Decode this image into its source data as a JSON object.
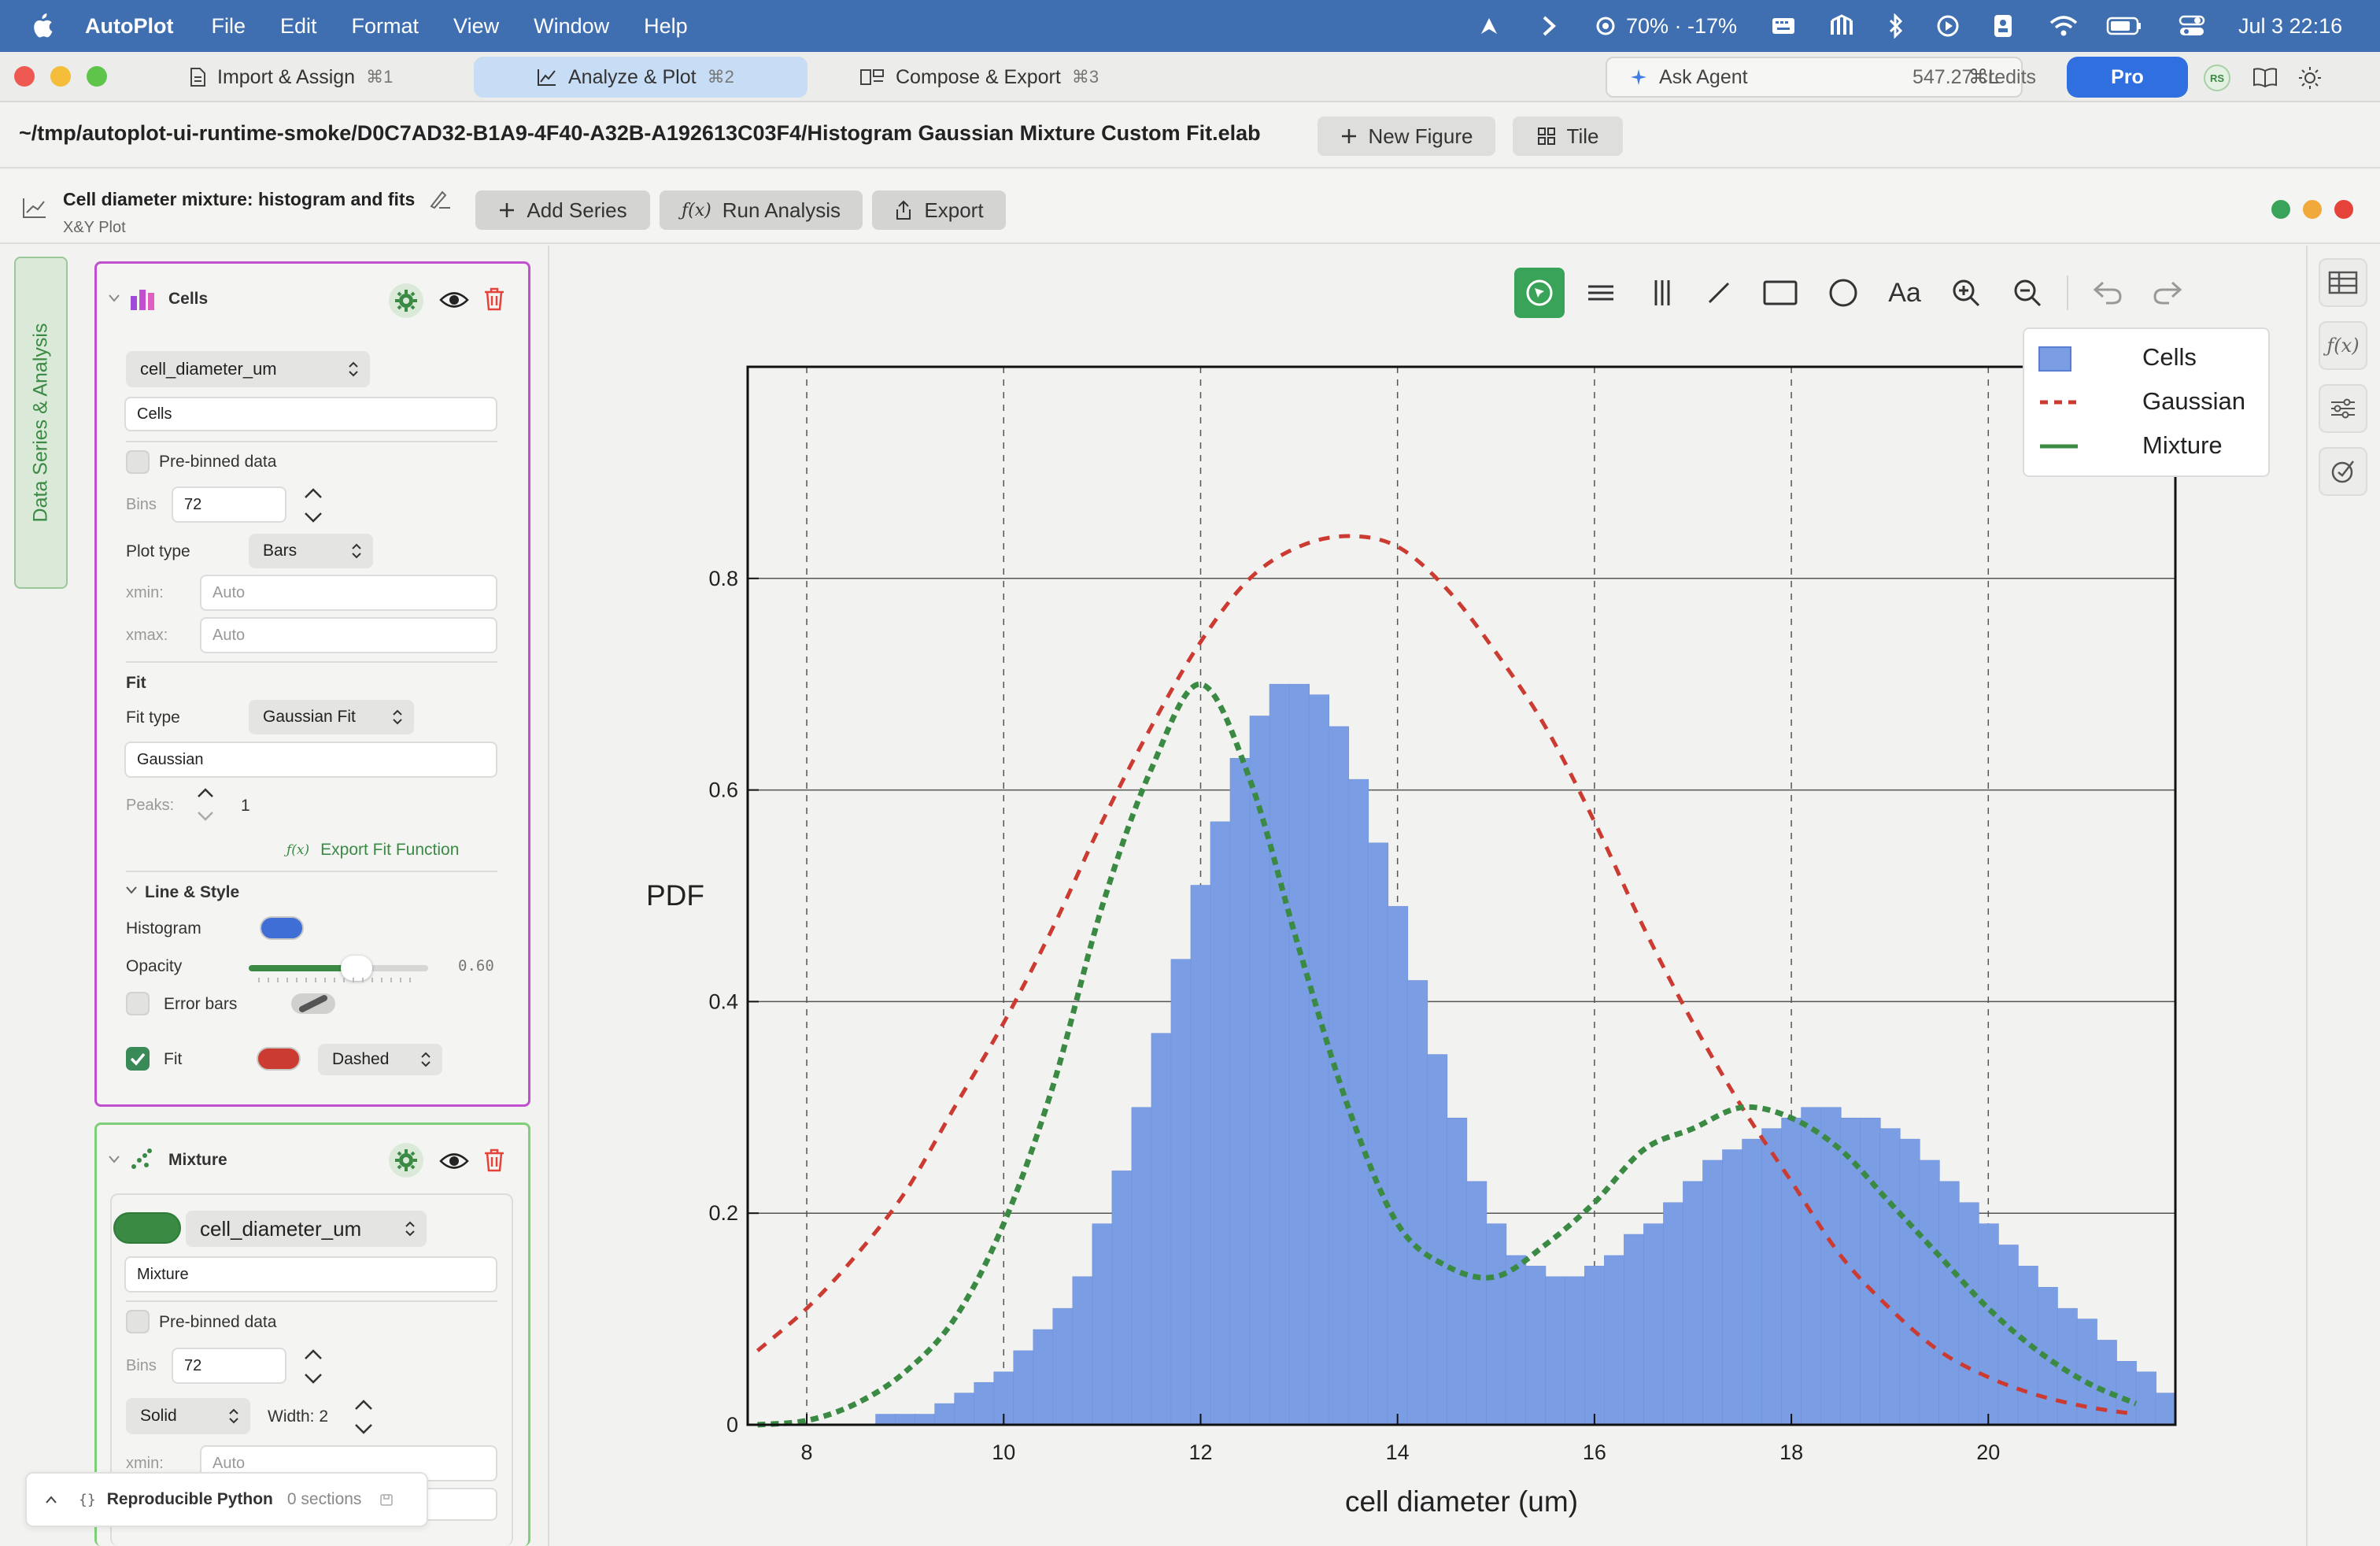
{
  "menubar": {
    "app_name": "AutoPlot",
    "menus": [
      "File",
      "Edit",
      "Format",
      "View",
      "Window",
      "Help"
    ],
    "battery_text": "70% · -17%",
    "clock": "Jul 3  22:16"
  },
  "tabs": [
    {
      "label": "Import & Assign",
      "shortcut": "⌘1",
      "active": false
    },
    {
      "label": "Analyze & Plot",
      "shortcut": "⌘2",
      "active": true
    },
    {
      "label": "Compose & Export",
      "shortcut": "⌘3",
      "active": false
    }
  ],
  "header_right": {
    "ask_agent": "Ask Agent",
    "ask_shortcut": "⌘L",
    "credits": "547.27 credits",
    "pro": "Pro",
    "avatar": "RS"
  },
  "pathbar": {
    "path": "~/tmp/autoplot-ui-runtime-smoke/D0C7AD32-B1A9-4F40-A32B-A192613C03F4/Histogram Gaussian Mixture Custom Fit.elab",
    "new_figure": "New Figure",
    "tile": "Tile"
  },
  "figure": {
    "title": "Cell diameter mixture: histogram and fits",
    "subtitle": "X&Y Plot",
    "add_series": "Add Series",
    "run_analysis": "Run Analysis",
    "export": "Export"
  },
  "left_rail": {
    "label": "Data Series & Analysis"
  },
  "series_cells": {
    "name": "Cells",
    "column": "cell_diameter_um",
    "display_name": "Cells",
    "prebinned_label": "Pre-binned data",
    "prebinned": false,
    "bins_label": "Bins",
    "bins": "72",
    "plot_type_label": "Plot type",
    "plot_type": "Bars",
    "xmin_label": "xmin:",
    "xmin_placeholder": "Auto",
    "xmax_label": "xmax:",
    "xmax_placeholder": "Auto",
    "fit_heading": "Fit",
    "fit_type_label": "Fit type",
    "fit_type": "Gaussian Fit",
    "fit_name": "Gaussian",
    "peaks_label": "Peaks:",
    "peaks": "1",
    "export_fit": "Export Fit Function",
    "style_heading": "Line & Style",
    "histogram_label": "Histogram",
    "histogram_color": "#3f6fd6",
    "opacity_label": "Opacity",
    "opacity": 0.6,
    "opacity_text": "0.60",
    "error_bars_label": "Error bars",
    "error_bars": false,
    "fit_label": "Fit",
    "fit_enabled": true,
    "fit_color": "#cc3b32",
    "fit_style": "Dashed"
  },
  "series_mixture": {
    "name": "Mixture",
    "color": "#3a8a44",
    "column": "cell_diameter_um",
    "display_name": "Mixture",
    "prebinned_label": "Pre-binned data",
    "prebinned": false,
    "bins_label": "Bins",
    "bins": "72",
    "line_style": "Solid",
    "width_label": "Width: 2",
    "xmin_label": "xmin:",
    "xmin_placeholder": "Auto"
  },
  "repro_python": {
    "label": "Reproducible Python",
    "sections": "0 sections"
  },
  "colors": {
    "accent_blue": "#3f6fb0",
    "bars": "#7b9de3",
    "gaussian": "#cc3b32",
    "mixture": "#3a8a44",
    "cells_border": "#c050d0",
    "mixture_border": "#7fcf7a"
  },
  "chart_data": {
    "type": "bar",
    "xlabel": "cell diameter (um)",
    "ylabel": "PDF",
    "xlim": [
      7.4,
      21.9
    ],
    "ylim": [
      0,
      1.0
    ],
    "xticks": [
      "8",
      "10",
      "12",
      "14",
      "16",
      "18",
      "20"
    ],
    "yticks": [
      "0",
      "0.2",
      "0.4",
      "0.6",
      "0.8"
    ],
    "grid": true,
    "legend_position": "top-right",
    "legend": [
      "Cells",
      "Gaussian",
      "Mixture"
    ],
    "series": [
      {
        "name": "Cells",
        "kind": "histogram",
        "bin_start": 7.5,
        "bin_width": 0.2,
        "values": [
          0.0,
          0.0,
          0.0,
          0.0,
          0.0,
          0.0,
          0.01,
          0.01,
          0.01,
          0.02,
          0.03,
          0.04,
          0.05,
          0.07,
          0.09,
          0.11,
          0.14,
          0.19,
          0.24,
          0.3,
          0.37,
          0.44,
          0.51,
          0.57,
          0.63,
          0.67,
          0.7,
          0.7,
          0.69,
          0.66,
          0.61,
          0.55,
          0.49,
          0.42,
          0.35,
          0.29,
          0.23,
          0.19,
          0.16,
          0.15,
          0.14,
          0.14,
          0.15,
          0.16,
          0.18,
          0.19,
          0.21,
          0.23,
          0.25,
          0.26,
          0.27,
          0.28,
          0.29,
          0.3,
          0.3,
          0.29,
          0.29,
          0.28,
          0.27,
          0.25,
          0.23,
          0.21,
          0.19,
          0.17,
          0.15,
          0.13,
          0.11,
          0.1,
          0.08,
          0.06,
          0.05,
          0.03
        ]
      },
      {
        "name": "Gaussian",
        "kind": "line",
        "style": "dashed",
        "x": [
          7.5,
          8,
          8.5,
          9,
          9.5,
          10,
          10.5,
          11,
          11.5,
          12,
          12.5,
          13,
          13.5,
          14,
          14.5,
          15,
          15.5,
          16,
          16.5,
          17,
          17.5,
          18,
          18.5,
          19,
          19.5,
          20,
          20.5,
          21,
          21.5
        ],
        "y": [
          0.07,
          0.11,
          0.16,
          0.22,
          0.3,
          0.38,
          0.47,
          0.57,
          0.66,
          0.74,
          0.8,
          0.83,
          0.84,
          0.83,
          0.79,
          0.73,
          0.66,
          0.57,
          0.47,
          0.38,
          0.3,
          0.23,
          0.16,
          0.11,
          0.07,
          0.045,
          0.028,
          0.017,
          0.01
        ]
      },
      {
        "name": "Mixture",
        "kind": "line",
        "style": "dashed",
        "x": [
          7.5,
          8,
          8.5,
          9,
          9.5,
          10,
          10.5,
          11,
          11.5,
          12,
          12.5,
          13,
          13.5,
          14,
          14.5,
          15,
          15.5,
          16,
          16.5,
          17,
          17.5,
          18,
          18.5,
          19,
          19.5,
          20,
          20.5,
          21,
          21.5
        ],
        "y": [
          0.0,
          0.004,
          0.02,
          0.05,
          0.1,
          0.19,
          0.32,
          0.49,
          0.62,
          0.7,
          0.61,
          0.45,
          0.3,
          0.19,
          0.15,
          0.14,
          0.17,
          0.21,
          0.26,
          0.28,
          0.3,
          0.29,
          0.26,
          0.21,
          0.16,
          0.11,
          0.07,
          0.04,
          0.02
        ]
      }
    ]
  }
}
